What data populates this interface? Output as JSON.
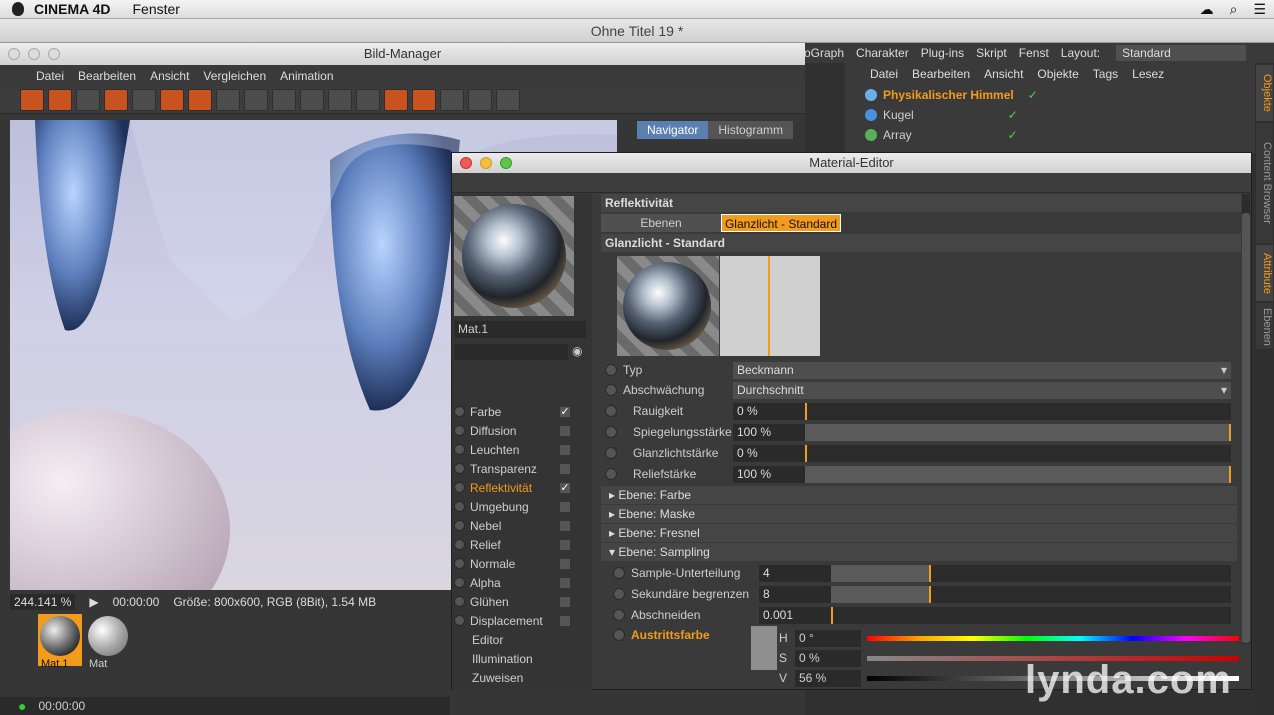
{
  "macbar": {
    "app": "CINEMA 4D",
    "menu": "Fenster"
  },
  "window_title": "Ohne Titel 19 *",
  "c4d_menu": [
    "oGraph",
    "Charakter",
    "Plug-ins",
    "Skript",
    "Fenst"
  ],
  "layout": {
    "label": "Layout:",
    "value": "Standard"
  },
  "object_manager": {
    "menu": [
      "Datei",
      "Bearbeiten",
      "Ansicht",
      "Objekte",
      "Tags",
      "Lesez"
    ],
    "objects": [
      {
        "name": "Physikalischer Himmel",
        "color": "#f39b1c"
      },
      {
        "name": "Kugel",
        "color": "#cfcfcf"
      },
      {
        "name": "Array",
        "color": "#cfcfcf"
      }
    ]
  },
  "side_tabs": [
    "Objekte",
    "Content Browser",
    "Attribute",
    "Ebenen"
  ],
  "bild_manager": {
    "title": "Bild-Manager",
    "menu": [
      "Datei",
      "Bearbeiten",
      "Ansicht",
      "Vergleichen",
      "Animation"
    ],
    "nav_tabs": [
      "Navigator",
      "Histogramm"
    ],
    "zoom": "244.141 %",
    "time": "00:00:00",
    "info": "Größe: 800x600, RGB (8Bit), 1.54 MB",
    "thumbs": [
      "Mat.1",
      "Mat"
    ],
    "timeline_time": "00:00:00"
  },
  "material_editor": {
    "title": "Material-Editor",
    "material_name": "Mat.1",
    "channels": [
      {
        "name": "Farbe",
        "checked": true
      },
      {
        "name": "Diffusion",
        "checked": false
      },
      {
        "name": "Leuchten",
        "checked": false
      },
      {
        "name": "Transparenz",
        "checked": false
      },
      {
        "name": "Reflektivität",
        "checked": true,
        "active": true
      },
      {
        "name": "Umgebung",
        "checked": false
      },
      {
        "name": "Nebel",
        "checked": false
      },
      {
        "name": "Relief",
        "checked": false
      },
      {
        "name": "Normale",
        "checked": false
      },
      {
        "name": "Alpha",
        "checked": false
      },
      {
        "name": "Glühen",
        "checked": false
      },
      {
        "name": "Displacement",
        "checked": false
      }
    ],
    "extra": [
      "Editor",
      "Illumination",
      "Zuweisen"
    ],
    "section": "Reflektivität",
    "tabs": [
      "Ebenen",
      "Glanzlicht - Standard"
    ],
    "layer_title": "Glanzlicht - Standard",
    "params": {
      "typ": {
        "label": "Typ",
        "value": "Beckmann"
      },
      "abschwaechung": {
        "label": "Abschwächung",
        "value": "Durchschnitt"
      },
      "rauigkeit": {
        "label": "Rauigkeit",
        "value": "0 %",
        "level": 0
      },
      "spiegelung": {
        "label": "Spiegelungsstärke",
        "value": "100 %",
        "level": 1
      },
      "glanzlicht": {
        "label": "Glanzlichtstärke",
        "value": "0 %",
        "level": 0
      },
      "relief": {
        "label": "Reliefstärke",
        "value": "100 %",
        "level": 1
      }
    },
    "groups": [
      "Ebene: Farbe",
      "Ebene: Maske",
      "Ebene: Fresnel",
      "Ebene: Sampling"
    ],
    "sampling": {
      "sample": {
        "label": "Sample-Unterteilung",
        "value": "4"
      },
      "sekundaer": {
        "label": "Sekundäre begrenzen",
        "value": "8"
      },
      "abschneiden": {
        "label": "Abschneiden",
        "value": "0.001"
      },
      "austritt": {
        "label": "Austrittsfarbe"
      }
    },
    "hsv": {
      "h": {
        "label": "H",
        "value": "0 °"
      },
      "s": {
        "label": "S",
        "value": "0 %"
      },
      "v": {
        "label": "V",
        "value": "56 %"
      }
    }
  },
  "watermark": "lynda.com"
}
